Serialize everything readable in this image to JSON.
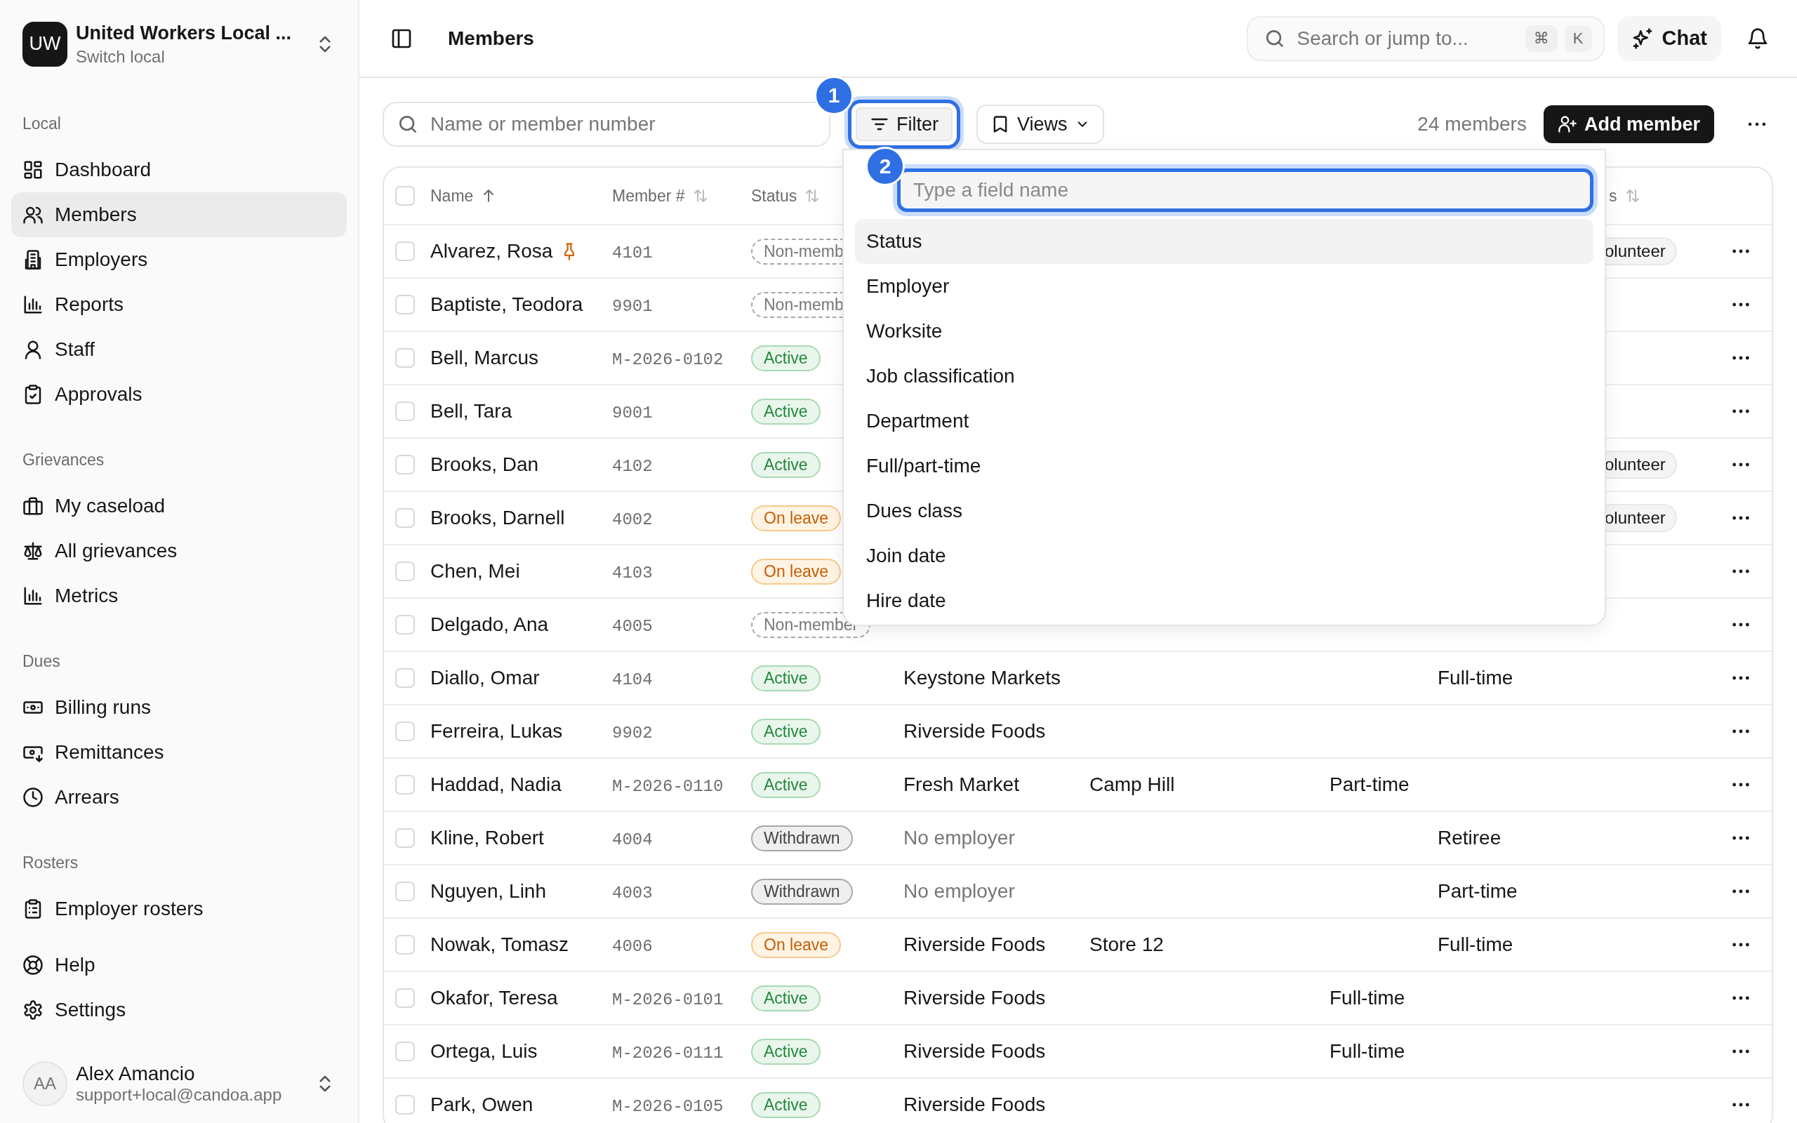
{
  "workspace": {
    "initials": "UW",
    "name": "United Workers Local ...",
    "subtitle": "Switch local"
  },
  "sidebar": {
    "sections": [
      {
        "label": "Local",
        "items": [
          {
            "label": "Dashboard",
            "selected": false
          },
          {
            "label": "Members",
            "selected": true
          },
          {
            "label": "Employers",
            "selected": false
          },
          {
            "label": "Reports",
            "selected": false
          },
          {
            "label": "Staff",
            "selected": false
          },
          {
            "label": "Approvals",
            "selected": false
          }
        ]
      },
      {
        "label": "Grievances",
        "items": [
          {
            "label": "My caseload",
            "selected": false
          },
          {
            "label": "All grievances",
            "selected": false
          },
          {
            "label": "Metrics",
            "selected": false
          }
        ]
      },
      {
        "label": "Dues",
        "items": [
          {
            "label": "Billing runs",
            "selected": false
          },
          {
            "label": "Remittances",
            "selected": false
          },
          {
            "label": "Arrears",
            "selected": false
          }
        ]
      },
      {
        "label": "Rosters",
        "items": [
          {
            "label": "Employer rosters",
            "selected": false
          }
        ]
      }
    ],
    "footer_items": [
      {
        "label": "Help",
        "selected": false
      },
      {
        "label": "Settings",
        "selected": false
      }
    ],
    "user": {
      "initials": "AA",
      "name": "Alex Amancio",
      "email": "support+local@candoa.app"
    }
  },
  "header": {
    "title": "Members",
    "search": {
      "placeholder": "Search or jump to...",
      "keys": [
        "⌘",
        "K"
      ]
    },
    "chat": "Chat"
  },
  "toolbar": {
    "search": {
      "placeholder": "Name or member number"
    },
    "filter": {
      "label": "Filter",
      "badge": "1",
      "focused": true
    },
    "views": "Views",
    "count": "24 members",
    "add": "Add member"
  },
  "field_picker": {
    "badge": "2",
    "placeholder": "Type a field name",
    "items": [
      {
        "label": "Status",
        "selected": true
      },
      {
        "label": "Employer",
        "selected": false
      },
      {
        "label": "Worksite",
        "selected": false
      },
      {
        "label": "Job classification",
        "selected": false
      },
      {
        "label": "Department",
        "selected": false
      },
      {
        "label": "Full/part-time",
        "selected": false
      },
      {
        "label": "Dues class",
        "selected": false
      },
      {
        "label": "Join date",
        "selected": false
      },
      {
        "label": "Hire date",
        "selected": false
      }
    ]
  },
  "table": {
    "all_checked": false,
    "columns": [
      {
        "label": "Name"
      },
      {
        "label": "Member #"
      },
      {
        "label": "Status"
      },
      {
        "label": "s"
      }
    ],
    "rows": [
      {
        "checked": false,
        "name": "Alvarez, Rosa",
        "pinned": true,
        "number": "4101",
        "status": {
          "label": "Non-memb",
          "kind": "non_member"
        },
        "tag": "olunteer"
      },
      {
        "checked": false,
        "name": "Baptiste, Teodora",
        "pinned": false,
        "number": "9901",
        "status": {
          "label": "Non-memb",
          "kind": "non_member"
        }
      },
      {
        "checked": false,
        "name": "Bell, Marcus",
        "pinned": false,
        "number": "M-2026-0102",
        "status": {
          "label": "Active",
          "kind": "active"
        }
      },
      {
        "checked": false,
        "name": "Bell, Tara",
        "pinned": false,
        "number": "9001",
        "status": {
          "label": "Active",
          "kind": "active"
        }
      },
      {
        "checked": false,
        "name": "Brooks, Dan",
        "pinned": false,
        "number": "4102",
        "status": {
          "label": "Active",
          "kind": "active"
        },
        "tag": "olunteer"
      },
      {
        "checked": false,
        "name": "Brooks, Darnell",
        "pinned": false,
        "number": "4002",
        "status": {
          "label": "On leave",
          "kind": "on_leave"
        },
        "tag": "olunteer"
      },
      {
        "checked": false,
        "name": "Chen, Mei",
        "pinned": false,
        "number": "4103",
        "status": {
          "label": "On leave",
          "kind": "on_leave"
        }
      },
      {
        "checked": false,
        "name": "Delgado, Ana",
        "pinned": false,
        "number": "4005",
        "status": {
          "label": "Non-member",
          "kind": "non_member"
        }
      },
      {
        "checked": false,
        "name": "Diallo, Omar",
        "pinned": false,
        "number": "4104",
        "status": {
          "label": "Active",
          "kind": "active"
        },
        "employer": "Keystone Markets",
        "employer_muted": false,
        "column_7": "Full-time"
      },
      {
        "checked": false,
        "name": "Ferreira, Lukas",
        "pinned": false,
        "number": "9902",
        "status": {
          "label": "Active",
          "kind": "active"
        },
        "employer": "Riverside Foods",
        "employer_muted": false
      },
      {
        "checked": false,
        "name": "Haddad, Nadia",
        "pinned": false,
        "number": "M-2026-0110",
        "status": {
          "label": "Active",
          "kind": "active"
        },
        "employer": "Fresh Market",
        "employer_muted": false,
        "worksite": "Camp Hill",
        "column_6": "Part-time"
      },
      {
        "checked": false,
        "name": "Kline, Robert",
        "pinned": false,
        "number": "4004",
        "status": {
          "label": "Withdrawn",
          "kind": "withdrawn"
        },
        "employer": "No employer",
        "employer_muted": true,
        "column_7": "Retiree"
      },
      {
        "checked": false,
        "name": "Nguyen, Linh",
        "pinned": false,
        "number": "4003",
        "status": {
          "label": "Withdrawn",
          "kind": "withdrawn"
        },
        "employer": "No employer",
        "employer_muted": true,
        "column_7": "Part-time"
      },
      {
        "checked": false,
        "name": "Nowak, Tomasz",
        "pinned": false,
        "number": "4006",
        "status": {
          "label": "On leave",
          "kind": "on_leave"
        },
        "employer": "Riverside Foods",
        "employer_muted": false,
        "worksite": "Store 12",
        "column_7": "Full-time"
      },
      {
        "checked": false,
        "name": "Okafor, Teresa",
        "pinned": false,
        "number": "M-2026-0101",
        "status": {
          "label": "Active",
          "kind": "active"
        },
        "employer": "Riverside Foods",
        "employer_muted": false,
        "column_6": "Full-time"
      },
      {
        "checked": false,
        "name": "Ortega, Luis",
        "pinned": false,
        "number": "M-2026-0111",
        "status": {
          "label": "Active",
          "kind": "active"
        },
        "employer": "Riverside Foods",
        "employer_muted": false,
        "column_6": "Full-time"
      },
      {
        "checked": false,
        "name": "Park, Owen",
        "pinned": false,
        "number": "M-2026-0105",
        "status": {
          "label": "Active",
          "kind": "active"
        },
        "employer": "Riverside Foods",
        "employer_muted": false
      }
    ]
  }
}
